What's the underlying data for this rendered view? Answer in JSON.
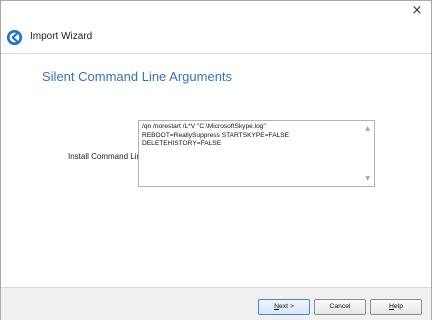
{
  "window": {
    "close_icon": "×"
  },
  "header": {
    "title": "Import Wizard",
    "icon": "arrow-circle-icon"
  },
  "section": {
    "title": "Silent Command Line Arguments"
  },
  "field": {
    "label": "Install Command Line",
    "value": "/qn /norestart /L*V \"C:\\MicrosoftSkype.log\" \nREBOOT=ReallySuppress STARTSKYPE=FALSE\nDELETEHISTORY=FALSE"
  },
  "buttons": {
    "next_label_underlined": "N",
    "next_label_rest": "ext >",
    "cancel_label": "Cancel",
    "help_label_underlined": "H",
    "help_label_rest": "elp"
  },
  "colors": {
    "accent": "#3a72b6",
    "footer_bg": "#f0f0f0"
  }
}
